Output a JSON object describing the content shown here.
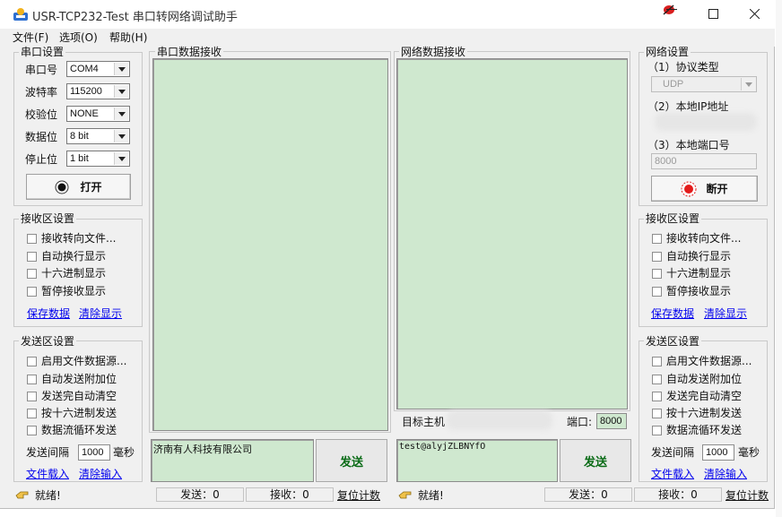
{
  "app": {
    "title": "USR-TCP232-Test 串口转网络调试助手"
  },
  "menu": [
    "文件(F)",
    "选项(O)",
    "帮助(H)"
  ],
  "serial": {
    "group_title": "串口设置",
    "fields": [
      {
        "label": "串口号",
        "value": "COM4"
      },
      {
        "label": "波特率",
        "value": "115200"
      },
      {
        "label": "校验位",
        "value": "NONE"
      },
      {
        "label": "数据位",
        "value": "8 bit"
      },
      {
        "label": "停止位",
        "value": "1 bit"
      }
    ],
    "open_button": "打开"
  },
  "left_receive": {
    "group_title": "接收区设置",
    "options": [
      "接收转向文件...",
      "自动换行显示",
      "十六进制显示",
      "暂停接收显示"
    ],
    "save_link": "保存数据",
    "clear_link": "清除显示"
  },
  "left_send": {
    "group_title": "发送区设置",
    "options": [
      "启用文件数据源...",
      "自动发送附加位",
      "发送完自动清空",
      "按十六进制发送",
      "数据流循环发送"
    ],
    "interval_label": "发送间隔",
    "interval_value": "1000",
    "interval_unit": "毫秒",
    "load_link": "文件载入",
    "clear_link": "清除输入"
  },
  "serial_receive": {
    "title": "串口数据接收"
  },
  "net_receive": {
    "title": "网络数据接收"
  },
  "serial_send": {
    "text": "济南有人科技有限公司",
    "button": "发送"
  },
  "net_send": {
    "target_label": "目标主机",
    "port_label": "端口:",
    "port_value": "8000",
    "text": "test@alyjZLBNYfO",
    "button": "发送"
  },
  "network": {
    "group_title": "网络设置",
    "protocol_label": "（1）协议类型",
    "protocol_value": "UDP",
    "ip_label": "（2）本地IP地址",
    "port_label": "（3）本地端口号",
    "port_value": "8000",
    "button": "断开"
  },
  "right_receive": {
    "group_title": "接收区设置",
    "options": [
      "接收转向文件...",
      "自动换行显示",
      "十六进制显示",
      "暂停接收显示"
    ],
    "save_link": "保存数据",
    "clear_link": "清除显示"
  },
  "right_send": {
    "group_title": "发送区设置",
    "options": [
      "启用文件数据源...",
      "自动发送附加位",
      "发送完自动清空",
      "按十六进制发送",
      "数据流循环发送"
    ],
    "interval_label": "发送间隔",
    "interval_value": "1000",
    "interval_unit": "毫秒",
    "load_link": "文件载入",
    "clear_link": "清除输入"
  },
  "status": {
    "left_ready": "就绪!",
    "left_sent": "发送：0",
    "left_recv": "接收：0",
    "left_reset": "复位计数",
    "right_ready": "就绪!",
    "right_sent": "发送：0",
    "right_recv": "接收：0",
    "right_reset": "复位计数"
  },
  "colors": {
    "receive_bg": "#cfe8cf",
    "send_text": "#0a6b16",
    "link": "#0000ee"
  },
  "icons": [
    "app-icon",
    "minimize-icon",
    "maximize-icon",
    "close-icon",
    "pin-icon",
    "status-hand-icon"
  ]
}
